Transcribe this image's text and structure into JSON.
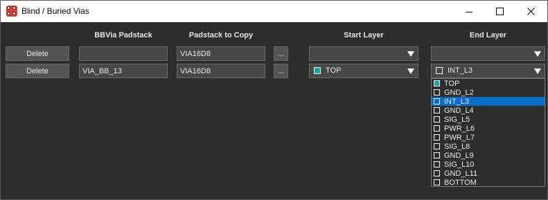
{
  "window": {
    "title": "Blind / Buried Vias",
    "minimize": "—",
    "maximize": "☐",
    "close": "✕"
  },
  "headers": {
    "bbvia_padstack": "BBVia Padstack",
    "padstack_to_copy": "Padstack to Copy",
    "start_layer": "Start Layer",
    "end_layer": "End Layer"
  },
  "rows": [
    {
      "delete_label": "Delete",
      "bbvia_padstack": "",
      "padstack_to_copy": "VIA16D8",
      "browse_label": "...",
      "start_layer": "",
      "end_layer": ""
    },
    {
      "delete_label": "Delete",
      "bbvia_padstack": "VIA_BB_13",
      "padstack_to_copy": "VIA16D8",
      "browse_label": "...",
      "start_layer": "TOP",
      "end_layer": "INT_L3"
    }
  ],
  "layer_options": [
    "TOP",
    "GND_L2",
    "INT_L3",
    "GND_L4",
    "SIG_L5",
    "PWR_L6",
    "PWR_L7",
    "SIG_L8",
    "GND_L9",
    "SIG_L10",
    "GND_L11",
    "BOTTOM"
  ],
  "selected_end_layer_index": 2,
  "colors": {
    "top_layer": "#16a3a3",
    "selection": "#0b6cc4",
    "background": "#2d2d2d"
  }
}
